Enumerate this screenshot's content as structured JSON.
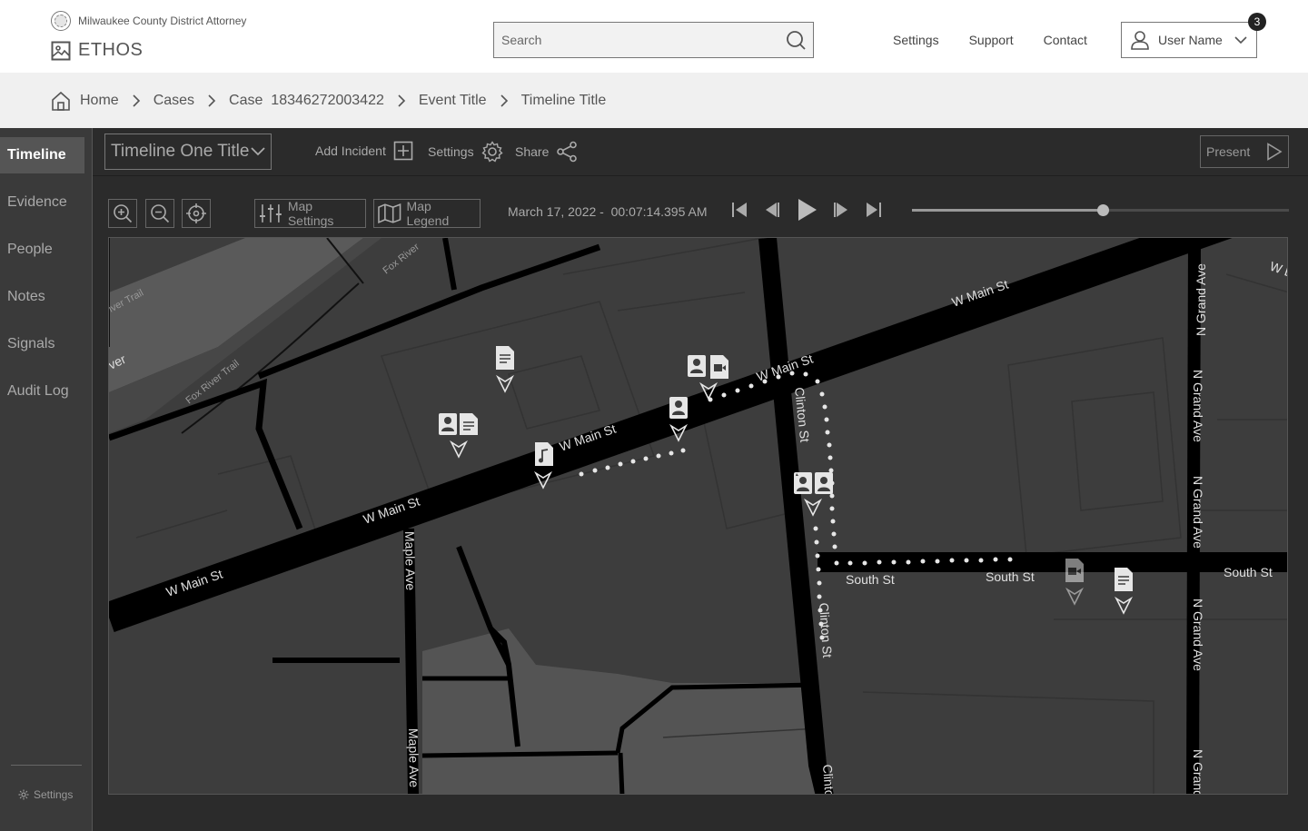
{
  "header": {
    "org_name": "Milwaukee County District Attorney",
    "product_name": "ETHOS",
    "search_placeholder": "Search",
    "links": [
      "Settings",
      "Support",
      "Contact"
    ],
    "user_name": "User Name",
    "notification_count": "3"
  },
  "breadcrumb": [
    "Home",
    "Cases",
    "Case  18346272003422",
    "Event Title",
    "Timeline Title"
  ],
  "sidebar": {
    "items": [
      {
        "label": "Timeline",
        "active": true
      },
      {
        "label": "Evidence",
        "active": false
      },
      {
        "label": "People",
        "active": false
      },
      {
        "label": "Notes",
        "active": false
      },
      {
        "label": "Signals",
        "active": false
      },
      {
        "label": "Audit Log",
        "active": false
      }
    ],
    "settings_label": "Settings"
  },
  "toolbar": {
    "timeline_selected": "Timeline One Title",
    "add_incident": "Add Incident",
    "settings": "Settings",
    "share": "Share",
    "present": "Present"
  },
  "map_controls": {
    "map_settings": "Map Settings",
    "map_legend": "Map Legend",
    "datetime": "March 17, 2022 -  00:07:14.395 AM",
    "progress": 0.506
  },
  "map": {
    "streets": {
      "w_main_1": "W Main St",
      "w_main_2": "W Main St",
      "w_main_3": "W Main St",
      "w_main_4": "W Main St",
      "w_main_5": "W Main St",
      "w_edge": "W E",
      "clinton_1": "Clinton St",
      "clinton_2": "Clinton St",
      "clinton_3": "Clinto",
      "maple_1": "Maple Ave",
      "maple_2": "Maple Ave",
      "south_1": "South St",
      "south_2": "South St",
      "south_3": "South St",
      "grand_1": "N Grand Ave",
      "grand_2": "N Grand Ave",
      "grand_3": "N Grand Ave",
      "grand_4": "N Grand Ave",
      "grand_5": "N Grand",
      "fox_river_1": "Fox River",
      "fox_river_2": "Fox River Trail",
      "river_trail": "iver Trail",
      "river": "ver"
    }
  },
  "colors": {
    "map_bg": "#3d3d3d",
    "road": "#000000",
    "river": "#5a5a5a",
    "marker": "#e6e6e6"
  }
}
